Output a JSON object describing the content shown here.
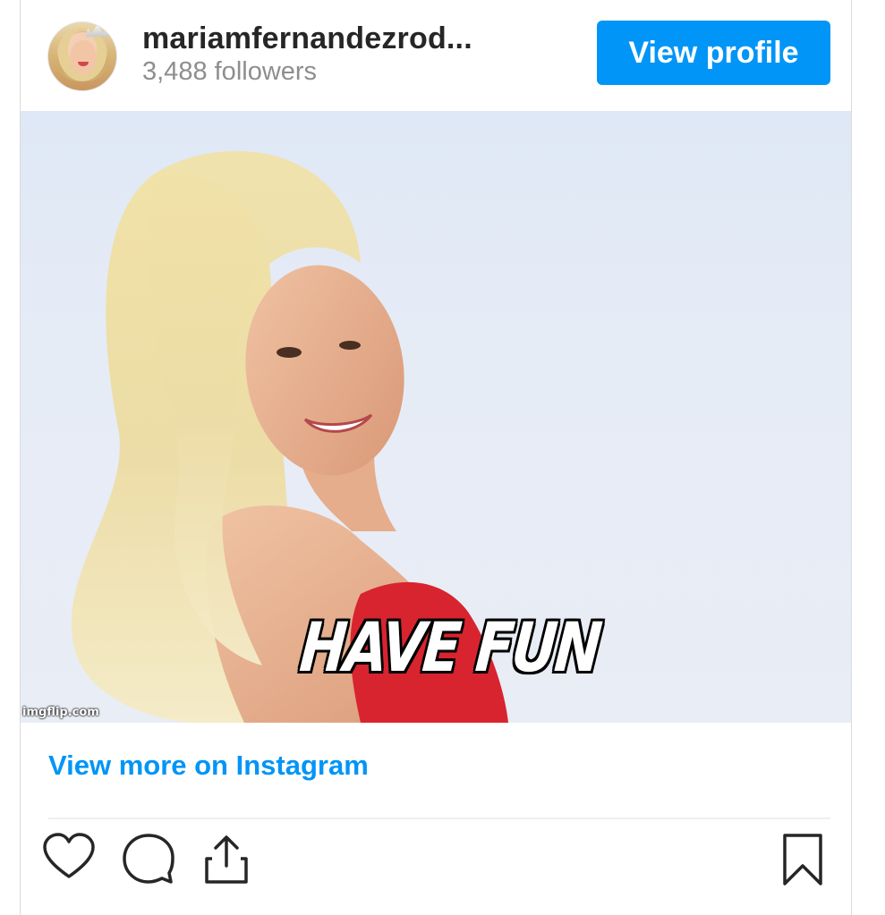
{
  "header": {
    "username": "mariamfernandezrod...",
    "followers": "3,488 followers",
    "view_profile_label": "View profile",
    "avatar_icon": "profile-avatar"
  },
  "media": {
    "caption": "HAVE FUN",
    "watermark": "imgflip.com"
  },
  "footer": {
    "view_more_label": "View more on Instagram",
    "actions": [
      "heart-icon",
      "comment-icon",
      "share-icon",
      "bookmark-icon"
    ]
  },
  "colors": {
    "accent": "#0095f6",
    "text_primary": "#262626",
    "text_secondary": "#8e8e8e"
  }
}
